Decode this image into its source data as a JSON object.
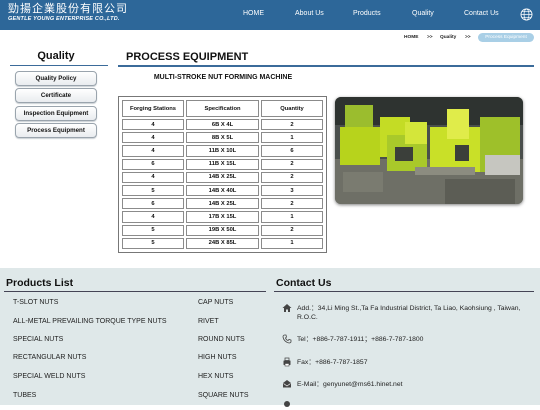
{
  "header": {
    "logo_cn": "勁揚企業股份有限公司",
    "logo_en": "GENTLE YOUNG ENTERPRISE CO.,LTD.",
    "nav": [
      "HOME",
      "About Us",
      "Products",
      "Quality",
      "Contact Us"
    ],
    "globe_icon": "globe-icon",
    "color": "#2d6799"
  },
  "sidebar": {
    "title": "Quality",
    "items": [
      "Quality Policy",
      "Certificate",
      "Inspection Equipment",
      "Process Equipment"
    ]
  },
  "breadcrumb": {
    "home": "HOME",
    "sep1": ">>",
    "section": "Quality",
    "sep2": ">>",
    "current": "Process Equipment"
  },
  "main": {
    "title": "PROCESS EQUIPMENT",
    "table_title": "MULTI-STROKE NUT FORMING MACHINE",
    "headers": [
      "Forging Stations",
      "Specification",
      "Quantity"
    ],
    "rows": [
      [
        "4",
        "6B X 4L",
        "2"
      ],
      [
        "4",
        "8B X 5L",
        "1"
      ],
      [
        "4",
        "11B X 10L",
        "6"
      ],
      [
        "6",
        "11B X 15L",
        "2"
      ],
      [
        "4",
        "14B X 25L",
        "2"
      ],
      [
        "5",
        "14B X 40L",
        "3"
      ],
      [
        "6",
        "14B X 25L",
        "2"
      ],
      [
        "4",
        "17B X 15L",
        "1"
      ],
      [
        "5",
        "19B X 50L",
        "2"
      ],
      [
        "5",
        "24B X 85L",
        "1"
      ]
    ]
  },
  "footer": {
    "products_title": "Products List",
    "products": [
      [
        "T-SLOT NUTS",
        "CAP NUTS"
      ],
      [
        "ALL-METAL PREVAILING TORQUE TYPE NUTS",
        "RIVET"
      ],
      [
        "SPECIAL NUTS",
        "ROUND NUTS"
      ],
      [
        "RECTANGULAR NUTS",
        "HIGH NUTS"
      ],
      [
        "SPECIAL WELD NUTS",
        "HEX NUTS"
      ],
      [
        "TUBES",
        "SQUARE NUTS"
      ]
    ],
    "contact_title": "Contact Us",
    "address": "Add.：34,Li Ming St.,Ta Fa Industrial District, Ta Liao, Kaohsiung , Taiwan, R.O.C.",
    "tel": "Tel：+886-7-787-1911；+886-7-787-1800",
    "fax": "Fax：+886-7-787-1857",
    "email": "E-Mail：genyunet@ms61.hinet.net"
  }
}
